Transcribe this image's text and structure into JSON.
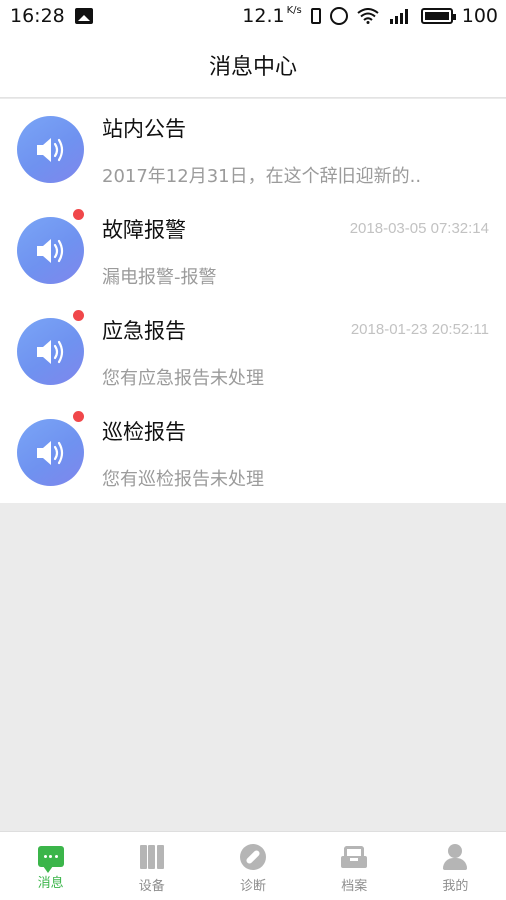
{
  "status_bar": {
    "time": "16:28",
    "speed": "12.1",
    "speed_unit": "K/s",
    "battery": "100"
  },
  "header": {
    "title": "消息中心"
  },
  "messages": [
    {
      "title": "站内公告",
      "time": "",
      "subtitle": "2017年12月31日，在这个辞旧迎新的..",
      "unread": false
    },
    {
      "title": "故障报警",
      "time": "2018-03-05 07:32:14",
      "subtitle": "漏电报警-报警",
      "unread": true
    },
    {
      "title": "应急报告",
      "time": "2018-01-23 20:52:11",
      "subtitle": "您有应急报告未处理",
      "unread": true
    },
    {
      "title": "巡检报告",
      "time": "",
      "subtitle": "您有巡检报告未处理",
      "unread": true
    }
  ],
  "tabs": [
    {
      "label": "消息",
      "icon": "chat-icon",
      "active": true
    },
    {
      "label": "设备",
      "icon": "device-icon",
      "active": false
    },
    {
      "label": "诊断",
      "icon": "compass-icon",
      "active": false
    },
    {
      "label": "档案",
      "icon": "archive-icon",
      "active": false
    },
    {
      "label": "我的",
      "icon": "person-icon",
      "active": false
    }
  ],
  "colors": {
    "accent": "#3bb54a",
    "badge": "#f0474a",
    "avatar": "#7099f2"
  }
}
